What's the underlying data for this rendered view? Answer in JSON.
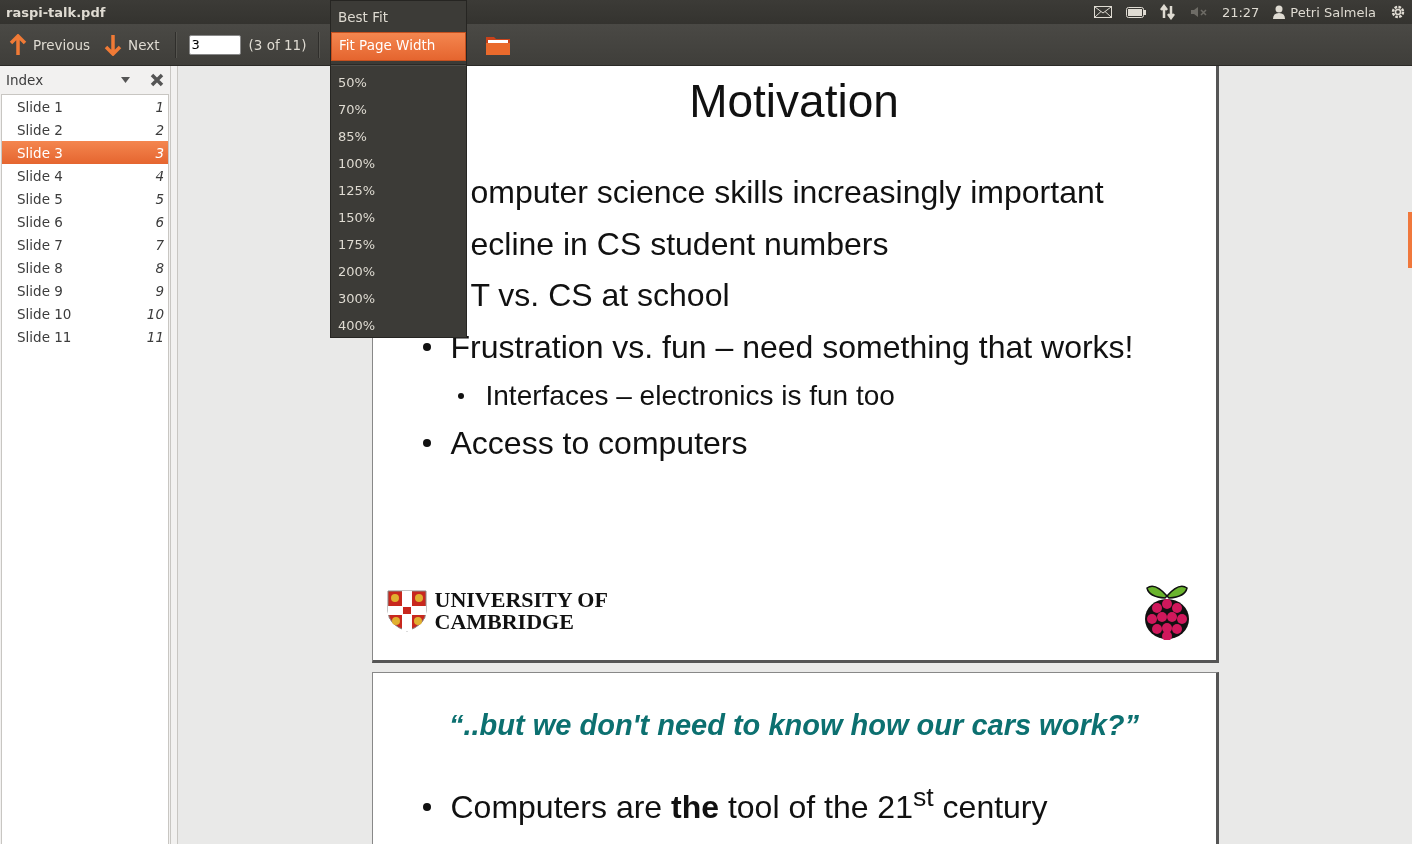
{
  "window": {
    "title": "raspi-talk.pdf"
  },
  "tray": {
    "time": "21:27",
    "user": "Petri Salmela",
    "sound_muted": true
  },
  "toolbar": {
    "previous": "Previous",
    "next": "Next",
    "page_value": "3",
    "page_count": "(3 of 11)"
  },
  "zoom_menu": {
    "items": [
      {
        "label": "Best Fit",
        "selected": false,
        "kind": "item"
      },
      {
        "label": "Fit Page Width",
        "selected": true,
        "kind": "item"
      },
      {
        "kind": "separator"
      },
      {
        "label": "50%",
        "selected": false,
        "kind": "item"
      },
      {
        "label": "70%",
        "selected": false,
        "kind": "item"
      },
      {
        "label": "85%",
        "selected": false,
        "kind": "item"
      },
      {
        "label": "100%",
        "selected": false,
        "kind": "item"
      },
      {
        "label": "125%",
        "selected": false,
        "kind": "item"
      },
      {
        "label": "150%",
        "selected": false,
        "kind": "item"
      },
      {
        "label": "175%",
        "selected": false,
        "kind": "item"
      },
      {
        "label": "200%",
        "selected": false,
        "kind": "item"
      },
      {
        "label": "300%",
        "selected": false,
        "kind": "item"
      },
      {
        "label": "400%",
        "selected": false,
        "kind": "item"
      }
    ]
  },
  "sidebar": {
    "title": "Index",
    "items": [
      {
        "label": "Slide 1",
        "page": "1",
        "selected": false
      },
      {
        "label": "Slide 2",
        "page": "2",
        "selected": false
      },
      {
        "label": "Slide 3",
        "page": "3",
        "selected": true
      },
      {
        "label": "Slide 4",
        "page": "4",
        "selected": false
      },
      {
        "label": "Slide 5",
        "page": "5",
        "selected": false
      },
      {
        "label": "Slide 6",
        "page": "6",
        "selected": false
      },
      {
        "label": "Slide 7",
        "page": "7",
        "selected": false
      },
      {
        "label": "Slide 8",
        "page": "8",
        "selected": false
      },
      {
        "label": "Slide 9",
        "page": "9",
        "selected": false
      },
      {
        "label": "Slide 10",
        "page": "10",
        "selected": false
      },
      {
        "label": "Slide 11",
        "page": "11",
        "selected": false
      }
    ]
  },
  "slides": [
    {
      "title": "Motivation",
      "bullets": [
        {
          "kind": "partial",
          "text": "omputer science skills increasingly important"
        },
        {
          "kind": "partial",
          "text": "ecline in CS student numbers"
        },
        {
          "kind": "partial",
          "text": "T vs. CS at school"
        },
        {
          "kind": "bullet",
          "text": "Frustration vs. fun – need something that works!",
          "children": [
            {
              "kind": "bullet",
              "text": "Interfaces – electronics is fun too"
            }
          ]
        },
        {
          "kind": "bullet",
          "text": "Access to computers"
        }
      ],
      "logo_lines": [
        "UNIVERSITY OF",
        "CAMBRIDGE"
      ]
    },
    {
      "quote": "“..but we don't need to know how our cars work?”",
      "bullets": [
        {
          "kind": "bullet",
          "text": "Computers are **the** tool of the 21$^{st}$ century"
        }
      ]
    }
  ]
}
